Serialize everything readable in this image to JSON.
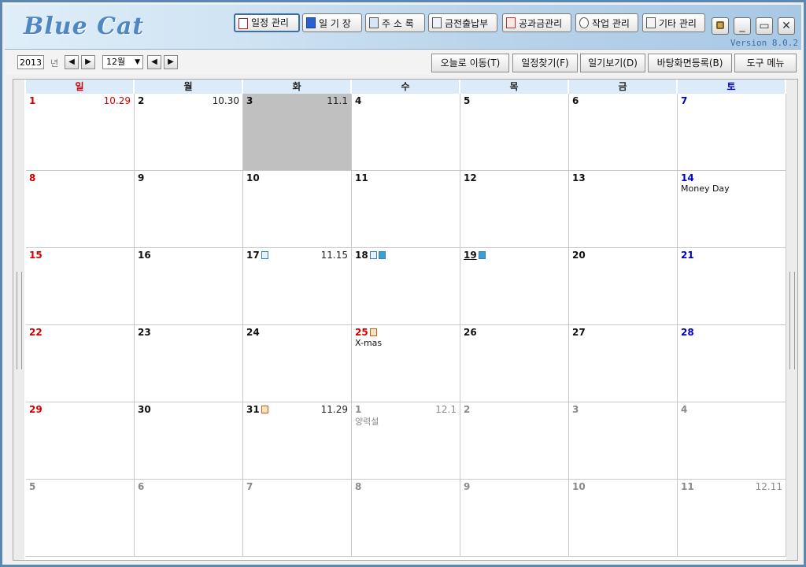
{
  "app": {
    "logo": "Blue Cat",
    "version": "Version 8.0.2"
  },
  "top_buttons": [
    {
      "label": "일정 관리",
      "icon": "calendar-icon",
      "active": true
    },
    {
      "label": "일 기 장",
      "icon": "book-icon"
    },
    {
      "label": "주 소 록",
      "icon": "addressbook-icon"
    },
    {
      "label": "금전출납부",
      "icon": "ledger-icon"
    },
    {
      "label": "공과금관리",
      "icon": "bill-icon"
    },
    {
      "label": "작업 관리",
      "icon": "clock-icon"
    },
    {
      "label": "기타 관리",
      "icon": "notepad-icon"
    }
  ],
  "window_controls": {
    "lock": "lock-icon",
    "minimize": "_",
    "maximize": "▭",
    "close": "✕"
  },
  "toolbar": {
    "year": "2013",
    "year_label": "년",
    "month": "12월",
    "prev": "◀",
    "next": "▶",
    "buttons": [
      "오늘로 이동(T)",
      "일정찾기(F)",
      "일기보기(D)",
      "바탕화면등록(B)",
      "도구 메뉴"
    ]
  },
  "weekdays": [
    "일",
    "월",
    "화",
    "수",
    "목",
    "금",
    "토"
  ],
  "weeks": [
    [
      {
        "d": "1",
        "l": "10.29"
      },
      {
        "d": "2",
        "l": "10.30"
      },
      {
        "d": "3",
        "l": "11.1",
        "sel": true
      },
      {
        "d": "4"
      },
      {
        "d": "5"
      },
      {
        "d": "6"
      },
      {
        "d": "7"
      }
    ],
    [
      {
        "d": "8"
      },
      {
        "d": "9"
      },
      {
        "d": "10"
      },
      {
        "d": "11"
      },
      {
        "d": "12"
      },
      {
        "d": "13"
      },
      {
        "d": "14",
        "n": "Money Day"
      }
    ],
    [
      {
        "d": "15"
      },
      {
        "d": "16"
      },
      {
        "d": "17",
        "l": "11.15",
        "badges": [
          "s"
        ]
      },
      {
        "d": "18",
        "badges": [
          "s",
          "b"
        ]
      },
      {
        "d": "19",
        "badges": [
          "b"
        ],
        "u": true
      },
      {
        "d": "20"
      },
      {
        "d": "21"
      }
    ],
    [
      {
        "d": "22"
      },
      {
        "d": "23"
      },
      {
        "d": "24"
      },
      {
        "d": "25",
        "n": "X-mas",
        "badges": [
          "o"
        ],
        "red": true
      },
      {
        "d": "26"
      },
      {
        "d": "27"
      },
      {
        "d": "28"
      }
    ],
    [
      {
        "d": "29"
      },
      {
        "d": "30"
      },
      {
        "d": "31",
        "l": "11.29",
        "badges": [
          "o"
        ]
      },
      {
        "d": "1",
        "l": "12.1",
        "n": "양력설",
        "other": true
      },
      {
        "d": "2",
        "other": true
      },
      {
        "d": "3",
        "other": true
      },
      {
        "d": "4",
        "other": true
      }
    ],
    [
      {
        "d": "5",
        "other": true
      },
      {
        "d": "6",
        "other": true
      },
      {
        "d": "7",
        "other": true
      },
      {
        "d": "8",
        "other": true
      },
      {
        "d": "9",
        "other": true
      },
      {
        "d": "10",
        "other": true
      },
      {
        "d": "11",
        "l": "12.11",
        "other": true
      }
    ]
  ]
}
